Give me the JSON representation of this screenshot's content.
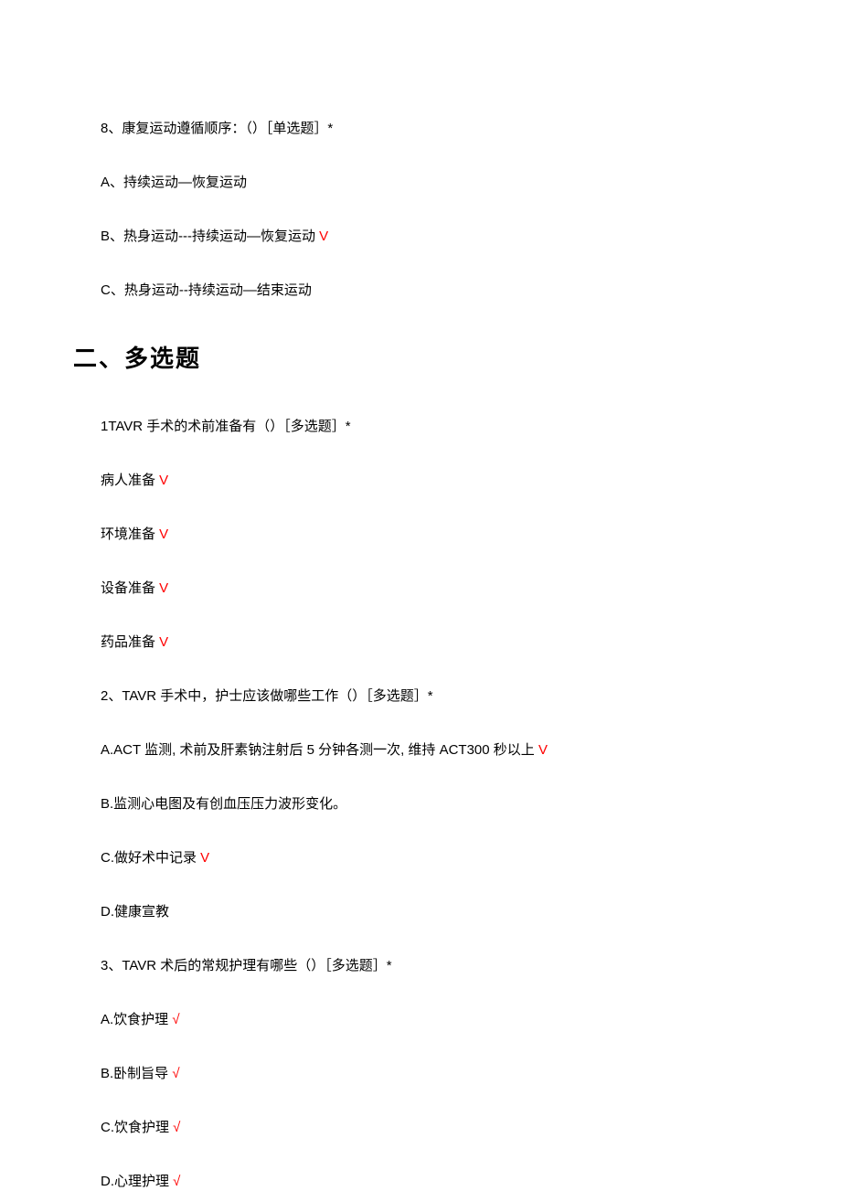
{
  "q8": {
    "prompt": "8、康复运动遵循顺序：（）［单选题］*",
    "optA": "A、持续运动—恢复运动",
    "optB_text": "B、热身运动---持续运动—恢复运动 ",
    "optB_mark": "V",
    "optC": "C、热身运动--持续运动—结束运动"
  },
  "section2": {
    "header": "二、多选题"
  },
  "mq1": {
    "prompt": "1TAVR 手术的术前准备有（）［多选题］*",
    "optA_text": "病人准备 ",
    "optA_mark": "V",
    "optB_text": "环境准备 ",
    "optB_mark": "V",
    "optC_text": "设备准备 ",
    "optC_mark": "V",
    "optD_text": "药品准备 ",
    "optD_mark": "V"
  },
  "mq2": {
    "prompt": "2、TAVR 手术中，护士应该做哪些工作（）［多选题］*",
    "optA_text": "A.ACT 监测, 术前及肝素钠注射后 5 分钟各测一次, 维持 ACT300 秒以上 ",
    "optA_mark": "V",
    "optB": "B.监测心电图及有创血压压力波形变化。",
    "optC_text": "C.做好术中记录 ",
    "optC_mark": "V",
    "optD": "D.健康宣教"
  },
  "mq3": {
    "prompt": "3、TAVR 术后的常规护理有哪些（）［多选题］*",
    "optA_text": "A.饮食护理 ",
    "optA_mark": "√",
    "optB_text": "B.卧制旨导 ",
    "optB_mark": "√",
    "optC_text": "C.饮食护理 ",
    "optC_mark": "√",
    "optD_text": "D.心理护理 ",
    "optD_mark": "√"
  }
}
